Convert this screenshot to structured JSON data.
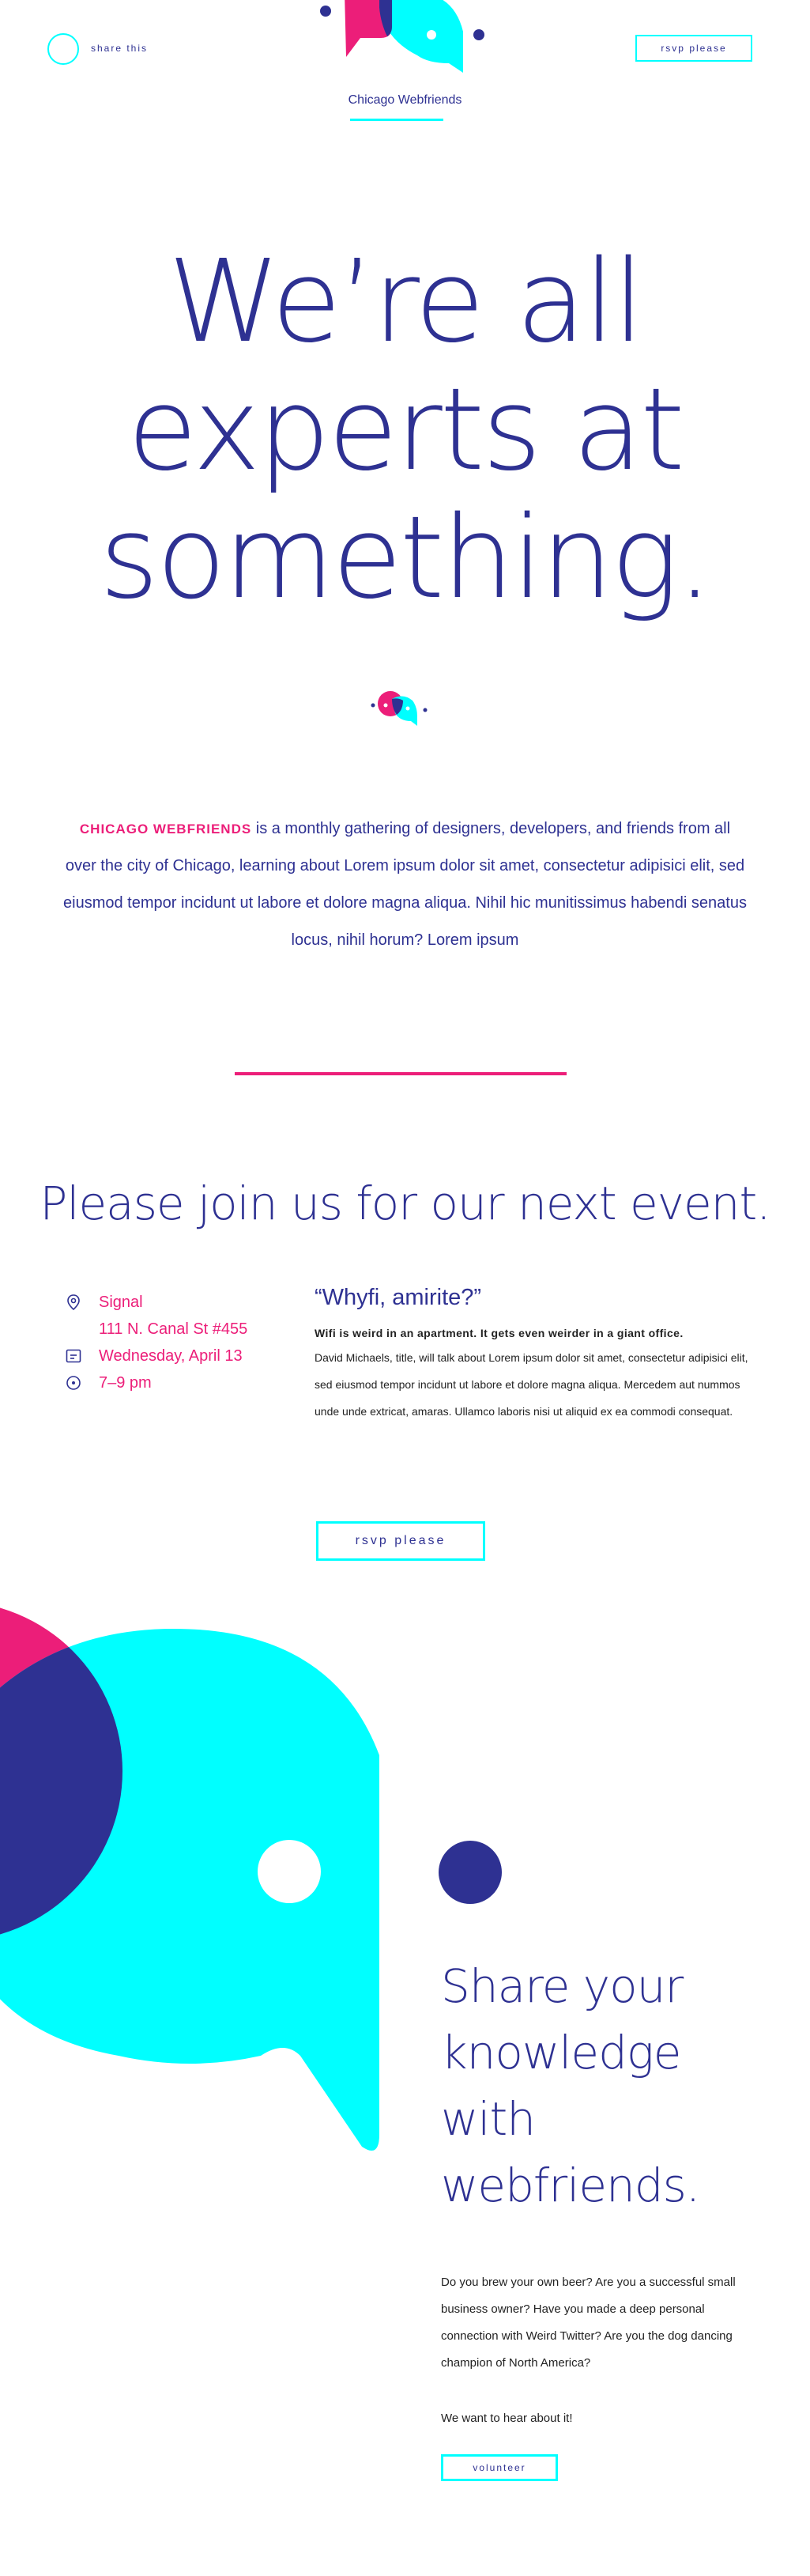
{
  "header": {
    "share_label": "share this",
    "rsvp_label": "rsvp please",
    "site_title": "Chicago Webfriends"
  },
  "hero": {
    "line1": "We’re all",
    "line2": "experts at",
    "line3": "something."
  },
  "intro": {
    "brand": "CHICAGO WEBFRIENDS",
    "text": " is a monthly gathering of designers, developers, and friends from all over the city of Chicago, learning about Lorem ipsum dolor sit amet, consectetur adipisici elit, sed eiusmod tempor incidunt ut labore et dolore magna aliqua. Nihil hic munitissimus habendi senatus locus, nihil horum? Lorem ipsum"
  },
  "event": {
    "heading": "Please join us for our next event.",
    "venue": "Signal",
    "address": "111 N. Canal St #455",
    "date": "Wednesday, April 13",
    "time": "7–9 pm",
    "talk_title": "“Whyfi, amirite?”",
    "talk_lead": "Wifi is weird in an apartment. It gets even weirder in a giant office.",
    "talk_body": "David Michaels, title, will talk about Lorem ipsum dolor sit amet, consectetur adipisici elit, sed eiusmod tempor incidunt ut labore et dolore magna aliqua. Mercedem aut nummos unde unde extricat, amaras. Ullamco laboris nisi ut aliquid ex ea commodi consequat.",
    "rsvp_label": "rsvp please"
  },
  "share": {
    "heading_line1": "Share your",
    "heading_line2": "knowledge",
    "heading_line3": "with",
    "heading_line4": "webfriends.",
    "copy": "Do you brew your own beer? Are you a successful small business owner? Have you made a deep personal connection with Weird Twitter? Are you the dog dancing champion of North America?",
    "cta": "We want to hear about it!",
    "volunteer_label": "volunteer"
  },
  "colors": {
    "navy": "#2e3192",
    "pink": "#ec1e79",
    "cyan": "#00ffff"
  },
  "icons": [
    "location-pin-icon",
    "calendar-icon",
    "clock-icon"
  ]
}
